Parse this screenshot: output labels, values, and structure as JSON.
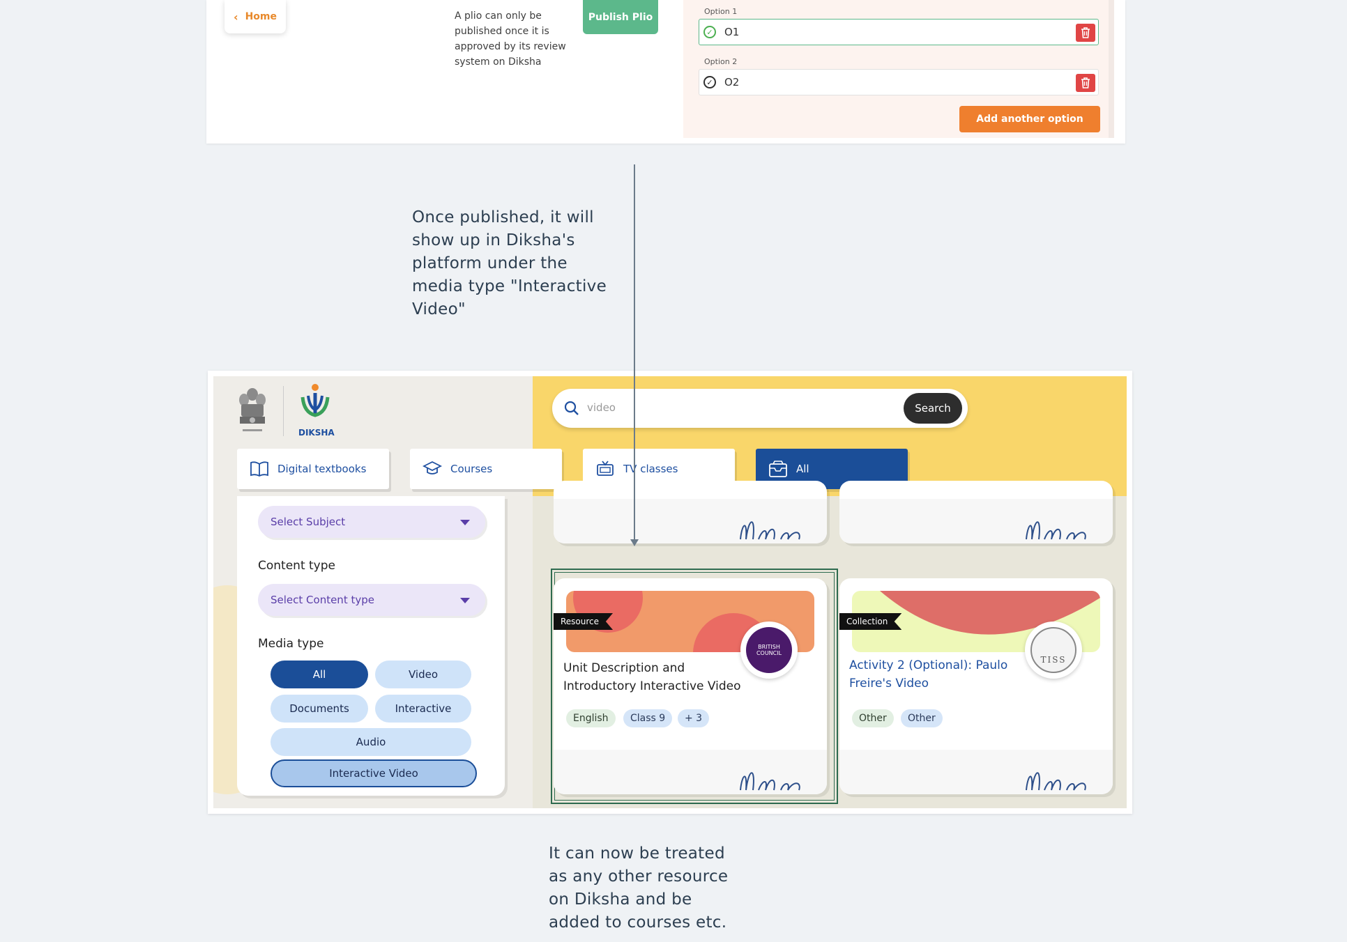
{
  "top_panel": {
    "home_label": "Home",
    "publish_note": "A plio can only be published once it is approved by its review system on Diksha",
    "publish_label": "Publish Plio",
    "options": [
      {
        "label": "Option 1",
        "value": "O1",
        "correct": true
      },
      {
        "label": "Option 2",
        "value": "O2",
        "correct": false
      }
    ],
    "add_option_label": "Add another option"
  },
  "annotations": {
    "first": "Once published, it will show up in Diksha's platform under the media type \"Interactive Video\"",
    "second": "It can now be treated as any other resource on Diksha and be added to courses etc."
  },
  "diksha": {
    "brand": "DIKSHA",
    "search_value": "video",
    "search_button": "Search",
    "tabs": [
      {
        "label": "Digital textbooks",
        "icon": "book-icon",
        "active": false
      },
      {
        "label": "Courses",
        "icon": "graduation-cap-icon",
        "active": false
      },
      {
        "label": "TV classes",
        "icon": "tv-icon",
        "active": false
      },
      {
        "label": "All",
        "icon": "inbox-icon",
        "active": true
      }
    ],
    "filters": {
      "subject_placeholder": "Select Subject",
      "content_type_label": "Content type",
      "content_type_placeholder": "Select Content type",
      "media_type_label": "Media type",
      "media_types": [
        "All",
        "Video",
        "Documents",
        "Interactive",
        "Audio",
        "Interactive Video"
      ]
    },
    "cards": [
      {
        "ribbon": "Resource",
        "title": "Unit Description and Introductory Interactive Video",
        "tags": [
          "English",
          "Class 9",
          "+ 3"
        ],
        "logo_text": "BRITISH COUNCIL"
      },
      {
        "ribbon": "Collection",
        "title": "Activity 2 (Optional): Paulo Freire's Video",
        "tags": [
          "Other",
          "Other"
        ],
        "logo_text": "TISS"
      }
    ],
    "colors": {
      "primary_blue": "#1b4e98",
      "header_yellow": "#f9d66a",
      "publish_green": "#5cb88b",
      "add_orange": "#ef7f2e",
      "delete_red": "#e04545"
    }
  }
}
